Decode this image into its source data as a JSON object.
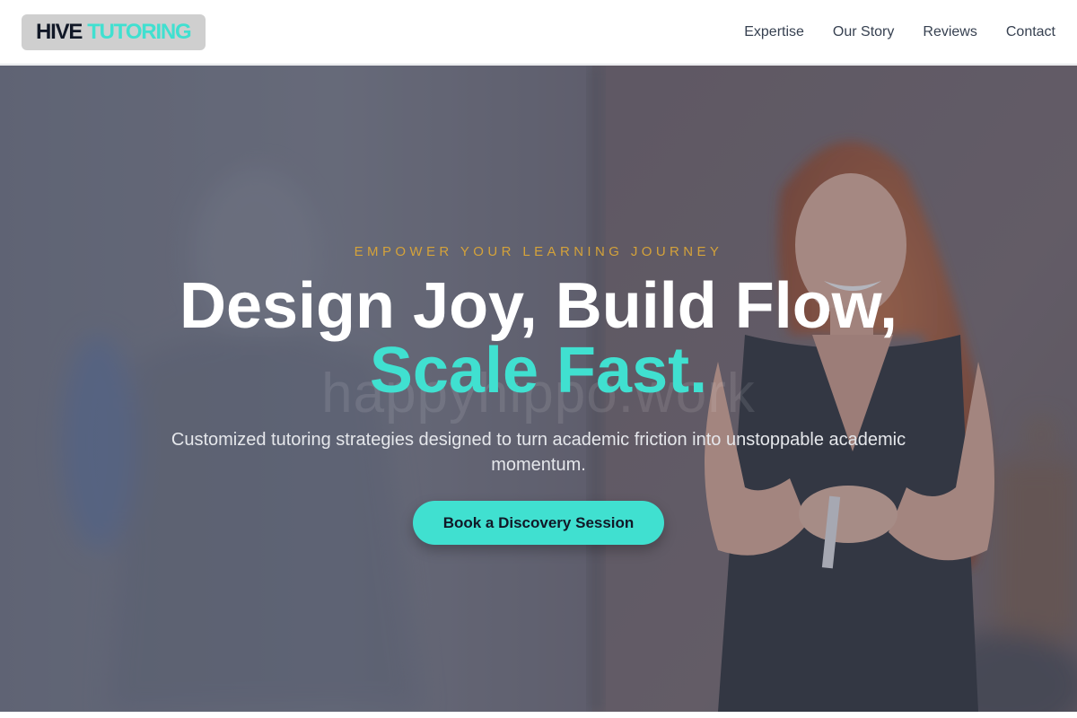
{
  "brand": {
    "part1": "HIVE",
    "part2": "TUTORING",
    "accent_color": "#40e0d0"
  },
  "nav": {
    "items": [
      "Expertise",
      "Our Story",
      "Reviews",
      "Contact"
    ]
  },
  "hero": {
    "eyebrow": "EMPOWER YOUR LEARNING JOURNEY",
    "headline_line1": "Design Joy, Build Flow,",
    "headline_line2": "Scale Fast.",
    "subtext": "Customized tutoring strategies designed to turn academic friction into unstoppable academic momentum.",
    "cta_label": "Book a Discovery Session",
    "watermark": "happyhippo.work",
    "eyebrow_color": "#d4a23a"
  }
}
